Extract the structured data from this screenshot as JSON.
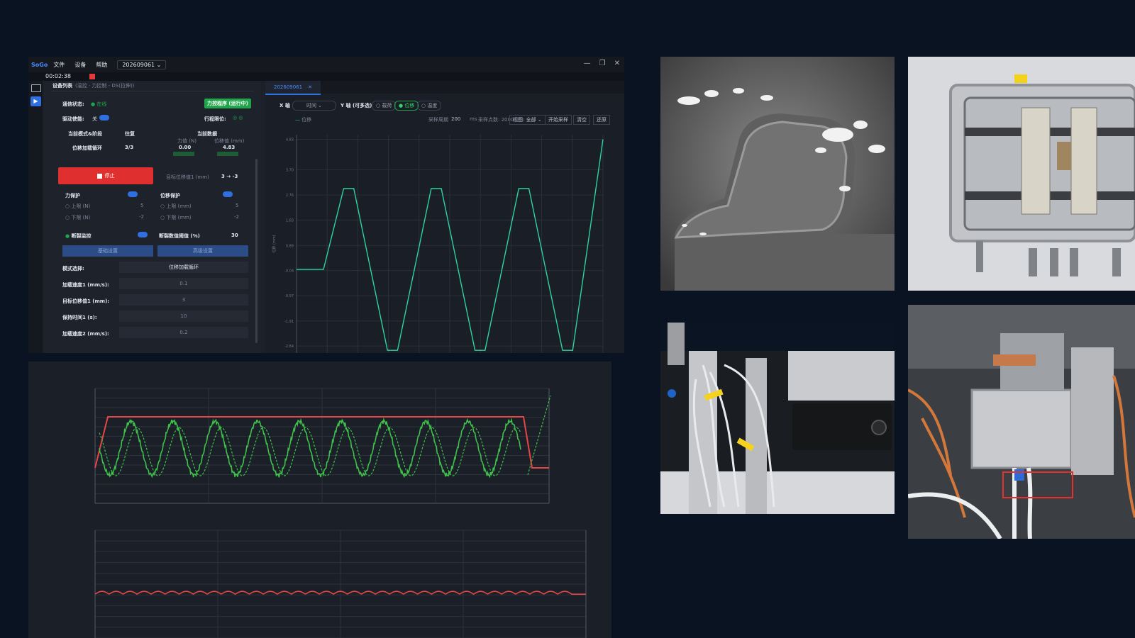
{
  "app": {
    "logo": "SoGo",
    "menu": [
      "文件",
      "设备",
      "帮助"
    ],
    "project": "202609061",
    "window_controls": [
      "—",
      "❐",
      "✕"
    ],
    "timer": "00:02:38"
  },
  "left_panel": {
    "title": "设备列表",
    "subtitle": "(温控 · 力控制 - DS(拉伸))",
    "comm_label": "通信状态:",
    "comm_value": "在线",
    "run_button": "力控程序 (运行中)",
    "drive_label": "驱动使能:",
    "drive_off": "关",
    "drive_on": "开",
    "limit_label": "行程限位:",
    "mode_stage_label": "当前模式&阶段",
    "progress_label": "往复",
    "current_data_label": "当前数据",
    "force_label": "力值 (N)",
    "disp_label": "位移值 (mm)",
    "mode_value": "位移加载循环",
    "progress_value": "3/3",
    "force_value": "0.00",
    "disp_value": "4.83",
    "stop_button": "停止",
    "target_disp_label": "目标位移值1 (mm)",
    "target_disp_value": "3 → -3",
    "force_protect": "力保护",
    "disp_protect": "位移保护",
    "upper_n": "上限 (N)",
    "lower_n": "下限 (N)",
    "upper_mm": "上限 (mm)",
    "lower_mm": "下限 (mm)",
    "upper_n_val": "5",
    "lower_n_val": "-2",
    "upper_mm_val": "5",
    "lower_mm_val": "-2",
    "onoff_on": "开",
    "onoff_off": "关",
    "break_monitor": "断裂监控",
    "threshold_label": "断裂数值阈值 (%)",
    "threshold_value": "30",
    "basic_settings": "基础设置",
    "advanced_settings": "高级设置",
    "mode_select_label": "模式选择:",
    "mode_select_value": "位移加载循环",
    "params": [
      {
        "label": "加载速度1 (mm/s):",
        "value": "0.1"
      },
      {
        "label": "目标位移值1 (mm):",
        "value": "3"
      },
      {
        "label": "保持时间1 (s):",
        "value": "10"
      },
      {
        "label": "加载速度2 (mm/s):",
        "value": "0.2"
      }
    ]
  },
  "right_panel": {
    "tab": "202609061",
    "x_axis_label": "X 轴",
    "x_axis_value": "时间",
    "y_axis_label": "Y 轴 (可多选)",
    "y_options": [
      {
        "label": "载荷",
        "on": false
      },
      {
        "label": "位移",
        "on": true
      },
      {
        "label": "温度",
        "on": false
      }
    ],
    "legend": "位移",
    "sample_period_label": "采样周期",
    "sample_period_value": "200",
    "sample_unit": "ms",
    "sample_count": "采样点数: 2000",
    "show_all": "视图: 全部",
    "buttons": [
      "开始采样",
      "清空",
      "还原"
    ],
    "ylabel": "位移 (mm)",
    "yticks": [
      "4.83",
      "3.70",
      "2.76",
      "1.83",
      "0.89",
      "-0.04",
      "-0.97",
      "-1.91",
      "-2.84"
    ]
  },
  "chart_data": [
    {
      "type": "line",
      "title": "",
      "legend": [
        "位移"
      ],
      "ylabel": "位移 (mm)",
      "yticks": [
        4.83,
        3.7,
        2.76,
        1.83,
        0.89,
        -0.04,
        -0.97,
        -1.91,
        -2.84
      ],
      "ylim": [
        -3.1,
        5.0
      ],
      "series": [
        {
          "name": "位移",
          "color": "#2fd3a0",
          "points": [
            [
              0,
              0
            ],
            [
              8,
              0
            ],
            [
              14,
              3
            ],
            [
              17,
              3
            ],
            [
              27,
              -3
            ],
            [
              30,
              -3
            ],
            [
              40,
              3
            ],
            [
              43,
              3
            ],
            [
              53,
              -3
            ],
            [
              56,
              -3
            ],
            [
              66,
              3
            ],
            [
              69,
              3
            ],
            [
              79,
              -3
            ],
            [
              82,
              -3
            ],
            [
              91,
              4.83
            ]
          ]
        }
      ],
      "grid": true
    },
    {
      "type": "line",
      "title": "",
      "series": [
        {
          "name": "",
          "color": "#e84545",
          "shape": "plateau",
          "level": 5.0
        },
        {
          "name": "",
          "color": "#3ec04a",
          "shape": "oscillation",
          "cycles": 10
        },
        {
          "name": "",
          "color": "#3ec04a",
          "shape": "oscillation-dashed",
          "cycles": 10
        }
      ],
      "grid": true
    },
    {
      "type": "line",
      "title": "",
      "series": [
        {
          "name": "",
          "color": "#e84545",
          "shape": "ripple",
          "level": 0.0,
          "cycles": 17
        }
      ],
      "grid": true
    }
  ],
  "photos": [
    {
      "name": "sem-sample-photo"
    },
    {
      "name": "stage-enclosure-photo"
    },
    {
      "name": "actuator-motor-photo"
    },
    {
      "name": "sample-holder-photo"
    }
  ],
  "colors": {
    "background": "#0a1322",
    "accent_blue": "#2f6fe0",
    "run_green": "#20a64a",
    "stop_red": "#e02f2f",
    "curve_cyan": "#2fd3a0"
  }
}
